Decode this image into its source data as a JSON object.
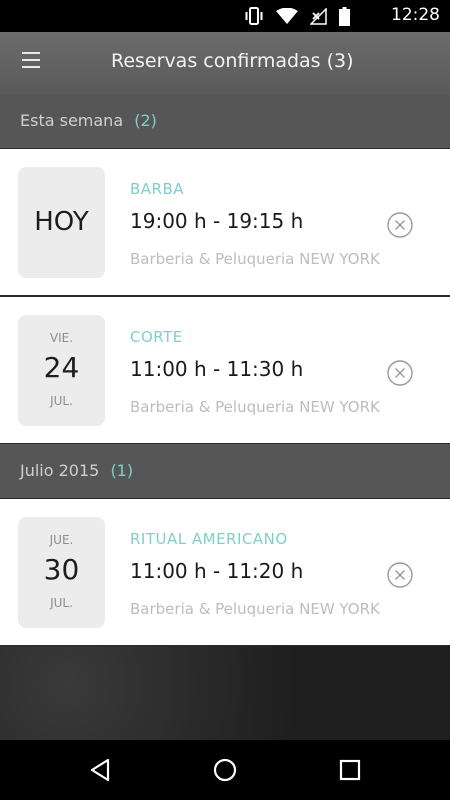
{
  "status_bar": {
    "time": "12:28"
  },
  "app_bar": {
    "title": "Reservas confirmadas  (3)"
  },
  "sections": [
    {
      "label": "Esta semana",
      "count": "(2)",
      "bookings": [
        {
          "date_label": "HOY",
          "dow": "",
          "day": "",
          "month": "",
          "service": "BARBA",
          "time": "19:00 h - 19:15 h",
          "venue": "Barberia & Peluqueria NEW YORK"
        },
        {
          "date_label": "",
          "dow": "VIE.",
          "day": "24",
          "month": "JUL.",
          "service": "CORTE",
          "time": "11:00 h - 11:30 h",
          "venue": "Barberia & Peluqueria NEW YORK"
        }
      ]
    },
    {
      "label": "Julio 2015",
      "count": "(1)",
      "bookings": [
        {
          "date_label": "",
          "dow": "JUE.",
          "day": "30",
          "month": "JUL.",
          "service": "RITUAL AMERICANO",
          "time": "11:00 h - 11:20 h",
          "venue": "Barberia & Peluqueria NEW YORK"
        }
      ]
    }
  ],
  "icons": {
    "menu": "hamburger-icon",
    "cancel": "cancel-circle-icon",
    "back": "back-triangle-icon",
    "home": "home-circle-icon",
    "recents": "recents-square-icon"
  },
  "colors": {
    "accent": "#7fcfc9",
    "section_bg": "#565656",
    "app_bar_bg": "#636363"
  }
}
